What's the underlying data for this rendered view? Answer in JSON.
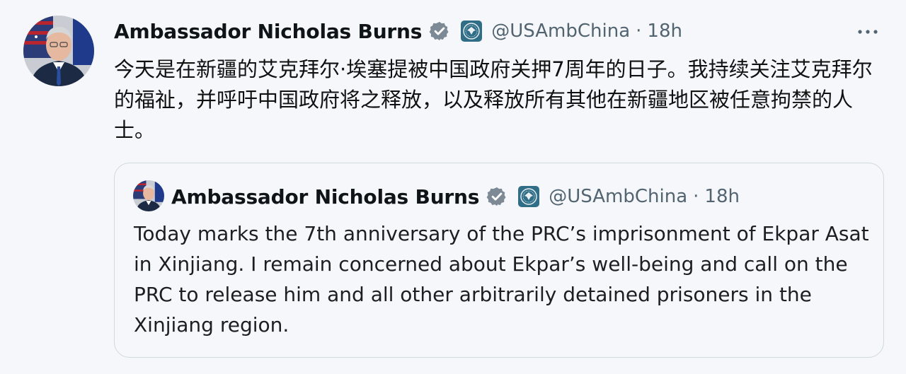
{
  "tweet": {
    "author_name": "Ambassador Nicholas Burns",
    "handle": "@USAmbChina",
    "separator": "·",
    "time": "18h",
    "text": "今天是在新疆的艾克拜尔·埃塞提被中国政府关押7周年的日子。我持续关注艾克拜尔的福祉，并呼吁中国政府将之释放，以及释放所有其他在新疆地区被任意拘禁的人士。",
    "more_icon": "more-horizontal-icon",
    "verified_icon": "verified-badge-icon",
    "affiliation_icon": "us-embassy-seal-icon"
  },
  "quoted_tweet": {
    "author_name": "Ambassador Nicholas Burns",
    "handle": "@USAmbChina",
    "separator": "·",
    "time": "18h",
    "text": "Today marks the 7th anniversary of the PRC’s imprisonment of Ekpar Asat in Xinjiang.  I remain concerned about Ekpar’s well-being and call on the PRC to release him and all other arbitrarily detained prisoners in the Xinjiang region."
  },
  "colors": {
    "background": "#f5f7fa",
    "text": "#0f1419",
    "secondary_text": "#536471",
    "verified_badge": "#7d8a96",
    "border": "#cfd9de"
  }
}
